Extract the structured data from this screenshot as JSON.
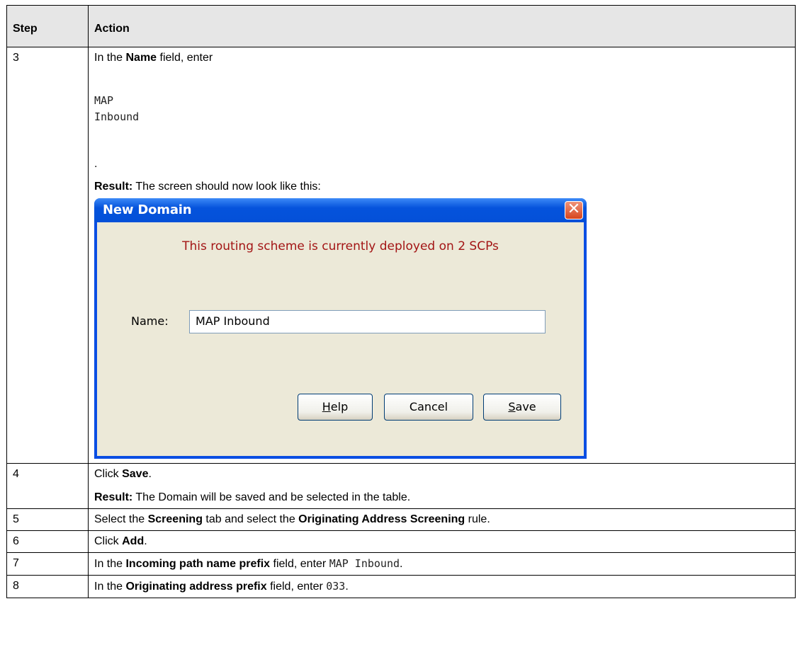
{
  "table": {
    "header": {
      "step": "Step",
      "action": "Action"
    },
    "row3": {
      "step": "3",
      "line1_pre": "In the ",
      "line1_bold": "Name",
      "line1_post": " field, enter",
      "code_line1": "MAP",
      "code_line2": "Inbound",
      "dot": ".",
      "result_label": "Result:",
      "result_text": " The screen should now look like this:"
    },
    "row4": {
      "step": "4",
      "pre": "Click ",
      "bold": "Save",
      "post": ".",
      "result_label": "Result:",
      "result_text": " The Domain will be saved and be selected in the table."
    },
    "row5": {
      "step": "5",
      "t1": "Select the ",
      "b1": "Screening",
      "t2": " tab and select the ",
      "b2": "Originating Address Screening",
      "t3": " rule."
    },
    "row6": {
      "step": "6",
      "pre": "Click ",
      "bold": "Add",
      "post": "."
    },
    "row7": {
      "step": "7",
      "pre": "In the ",
      "bold": "Incoming path name prefix",
      "mid": " field, enter ",
      "code": "MAP Inbound",
      "post": "."
    },
    "row8": {
      "step": "8",
      "pre": "In the ",
      "bold": "Originating address prefix",
      "mid": " field, enter ",
      "code": "033",
      "post": "."
    }
  },
  "dialog": {
    "title": "New Domain",
    "close_glyph": "✕",
    "message": "This routing scheme is currently deployed on 2 SCPs",
    "name_label": "Name:",
    "name_value": "MAP Inbound",
    "help_underlined": "H",
    "help_rest": "elp",
    "cancel_label": "Cancel",
    "save_underlined": "S",
    "save_rest": "ave",
    "colors": {
      "title_bar": "#0553dc",
      "body": "#ece9d8",
      "message": "#a31515",
      "close": "#d6451d"
    }
  }
}
